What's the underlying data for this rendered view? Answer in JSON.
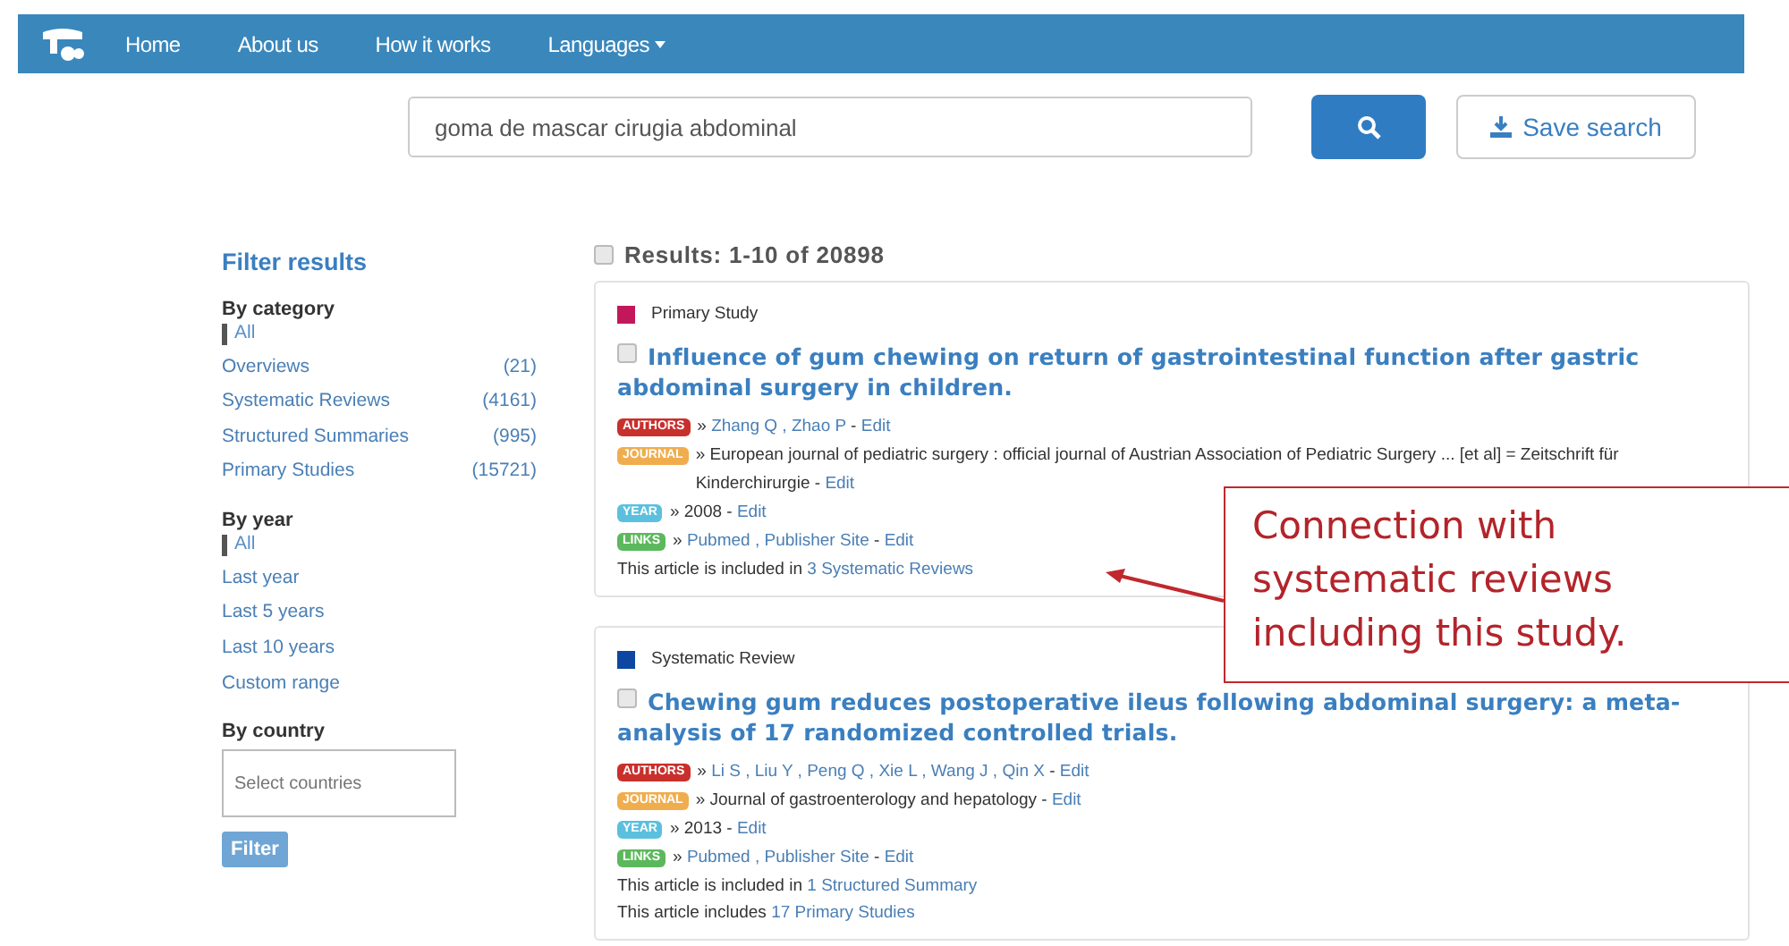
{
  "navbar": {
    "items": [
      {
        "label": "Home",
        "dropdown": false
      },
      {
        "label": "About us",
        "dropdown": false
      },
      {
        "label": "How it works",
        "dropdown": false
      },
      {
        "label": "Languages",
        "dropdown": true
      }
    ]
  },
  "search": {
    "value": "goma de mascar cirugia abdominal",
    "save_label": "Save search"
  },
  "sidebar": {
    "title": "Filter results",
    "groups": [
      {
        "heading": "By category",
        "items": [
          {
            "label": "All",
            "selected": true
          },
          {
            "label": "Overviews",
            "count": "(21)",
            "selected": false
          },
          {
            "label": "Systematic Reviews",
            "count": "(4161)",
            "selected": false
          },
          {
            "label": "Structured Summaries",
            "count": "(995)",
            "selected": false
          },
          {
            "label": "Primary Studies",
            "count": "(15721)",
            "selected": false
          }
        ]
      },
      {
        "heading": "By year",
        "items": [
          {
            "label": "All",
            "selected": true
          },
          {
            "label": "Last year",
            "selected": false
          },
          {
            "label": "Last 5 years",
            "selected": false
          },
          {
            "label": "Last 10 years",
            "selected": false
          },
          {
            "label": "Custom range",
            "selected": false
          }
        ]
      }
    ],
    "country": {
      "heading": "By country",
      "placeholder": "Select countries"
    },
    "filter_button": "Filter"
  },
  "results": {
    "summary": "Results: 1-10 of 20898",
    "checked": false,
    "items": [
      {
        "category": "Primary Study",
        "color": "#c2185b",
        "checked": false,
        "title": "Influence of gum chewing on return of gastrointestinal function after gastric abdominal surgery in children.",
        "rows": [
          {
            "badge": "AUTHORS",
            "color": "#c9302c",
            "parts": [
              {
                "text": "»",
                "kind": "text"
              },
              {
                "text": "Zhang Q , Zhao P",
                "kind": "link"
              },
              {
                "text": "-",
                "kind": "text"
              },
              {
                "text": "Edit",
                "kind": "link"
              }
            ]
          },
          {
            "badge": "JOURNAL",
            "color": "#f0ad4e",
            "parts": [
              {
                "text": "» European journal of pediatric surgery : official journal of Austrian Association of Pediatric Surgery ... [et al] = Zeitschrift für Kinderchirurgie -",
                "kind": "text"
              },
              {
                "text": "Edit",
                "kind": "link"
              }
            ]
          },
          {
            "badge": "YEAR",
            "color": "#5bc0de",
            "parts": [
              {
                "text": "» 2008 -",
                "kind": "text"
              },
              {
                "text": "Edit",
                "kind": "link"
              }
            ]
          },
          {
            "badge": "LINKS",
            "color": "#5cb85c",
            "parts": [
              {
                "text": "»",
                "kind": "text"
              },
              {
                "text": "Pubmed , Publisher Site",
                "kind": "link"
              },
              {
                "text": "-",
                "kind": "text"
              },
              {
                "text": "Edit",
                "kind": "link"
              }
            ]
          }
        ],
        "notes": [
          {
            "text": "This article is included in",
            "link": "3 Systematic Reviews"
          }
        ]
      },
      {
        "category": "Systematic Review",
        "color": "#0d47a1",
        "checked": false,
        "title": "Chewing gum reduces postoperative ileus following abdominal surgery: a meta-analysis of 17 randomized controlled trials.",
        "rows": [
          {
            "badge": "AUTHORS",
            "color": "#c9302c",
            "parts": [
              {
                "text": "»",
                "kind": "text"
              },
              {
                "text": "Li S , Liu Y , Peng Q , Xie L , Wang J , Qin X",
                "kind": "link"
              },
              {
                "text": "-",
                "kind": "text"
              },
              {
                "text": "Edit",
                "kind": "link"
              }
            ]
          },
          {
            "badge": "JOURNAL",
            "color": "#f0ad4e",
            "parts": [
              {
                "text": "» Journal of gastroenterology and hepatology -",
                "kind": "text"
              },
              {
                "text": "Edit",
                "kind": "link"
              }
            ]
          },
          {
            "badge": "YEAR",
            "color": "#5bc0de",
            "parts": [
              {
                "text": "» 2013 -",
                "kind": "text"
              },
              {
                "text": "Edit",
                "kind": "link"
              }
            ]
          },
          {
            "badge": "LINKS",
            "color": "#5cb85c",
            "parts": [
              {
                "text": "»",
                "kind": "text"
              },
              {
                "text": "Pubmed , Publisher Site",
                "kind": "link"
              },
              {
                "text": "-",
                "kind": "text"
              },
              {
                "text": "Edit",
                "kind": "link"
              }
            ]
          }
        ],
        "notes": [
          {
            "text": "This article is included in",
            "link": "1 Structured Summary"
          },
          {
            "text": "This article includes",
            "link": "17 Primary Studies"
          }
        ]
      }
    ]
  },
  "annotation": {
    "text": "Connection with systematic reviews including this study."
  }
}
